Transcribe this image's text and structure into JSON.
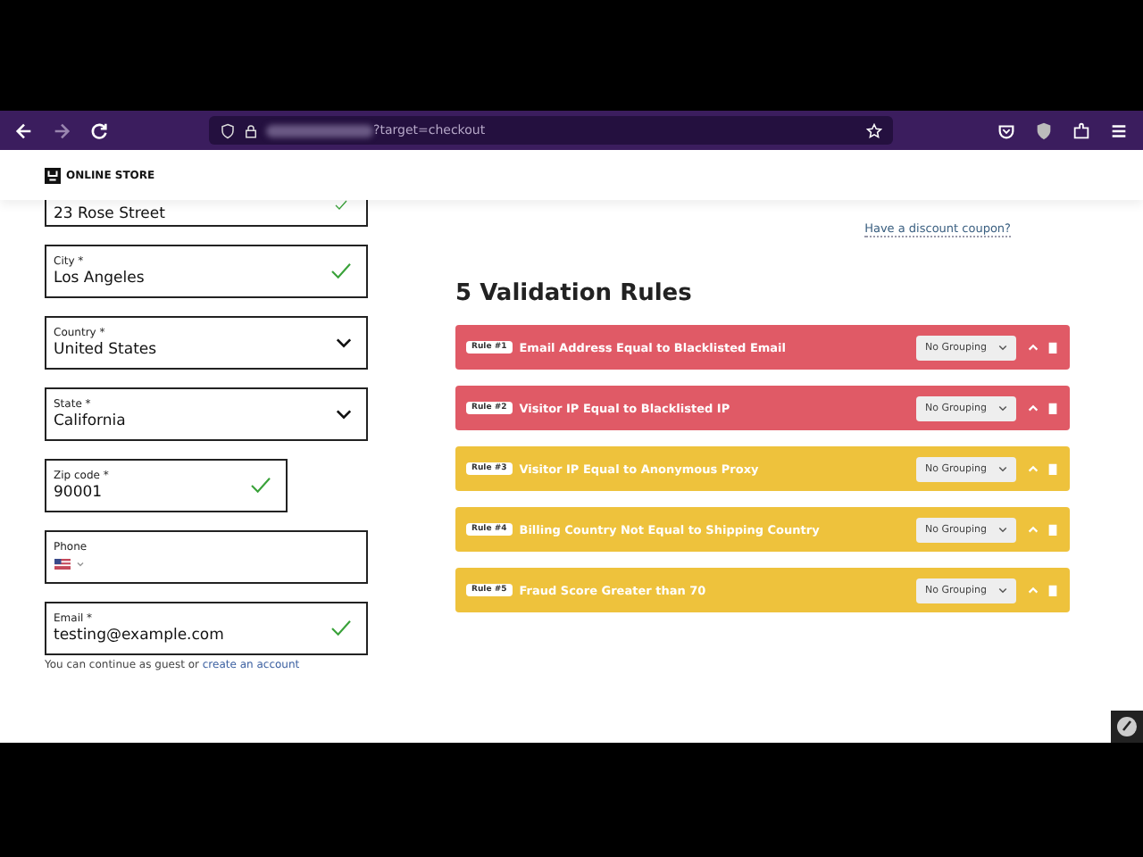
{
  "browser": {
    "url": "?target=checkout"
  },
  "store": {
    "name": "ONLINE STORE"
  },
  "fields": [
    {
      "kind": "partial",
      "value": "23 Rose Street",
      "valid": true,
      "narrow": false
    },
    {
      "kind": "text",
      "label": "City *",
      "value": "Los Angeles",
      "valid": true,
      "narrow": false
    },
    {
      "kind": "select",
      "label": "Country *",
      "value": "United States",
      "valid": false,
      "narrow": false
    },
    {
      "kind": "select",
      "label": "State *",
      "value": "California",
      "valid": false,
      "narrow": false
    },
    {
      "kind": "text",
      "label": "Zip code *",
      "value": "90001",
      "valid": true,
      "narrow": true
    },
    {
      "kind": "phone",
      "label": "Phone",
      "valid": false,
      "narrow": false
    },
    {
      "kind": "text",
      "label": "Email *",
      "value": "testing@example.com",
      "valid": true,
      "narrow": false
    }
  ],
  "guest_note": {
    "text": "You can continue as guest or",
    "link": "create an account"
  },
  "coupon_link": "Have a discount coupon?",
  "rules_heading": "5 Validation Rules",
  "rules": [
    {
      "badge": "Rule #1",
      "title": "Email Address Equal to Blacklisted Email",
      "grouping": "No Grouping",
      "color": "#e05a66"
    },
    {
      "badge": "Rule #2",
      "title": "Visitor IP Equal to Blacklisted IP",
      "grouping": "No Grouping",
      "color": "#e05a66"
    },
    {
      "badge": "Rule #3",
      "title": "Visitor IP Equal to Anonymous Proxy",
      "grouping": "No Grouping",
      "color": "#eec23c"
    },
    {
      "badge": "Rule #4",
      "title": "Billing Country Not Equal to Shipping Country",
      "grouping": "No Grouping",
      "color": "#eec23c"
    },
    {
      "badge": "Rule #5",
      "title": "Fraud Score Greater than 70",
      "grouping": "No Grouping",
      "color": "#eec23c"
    }
  ]
}
